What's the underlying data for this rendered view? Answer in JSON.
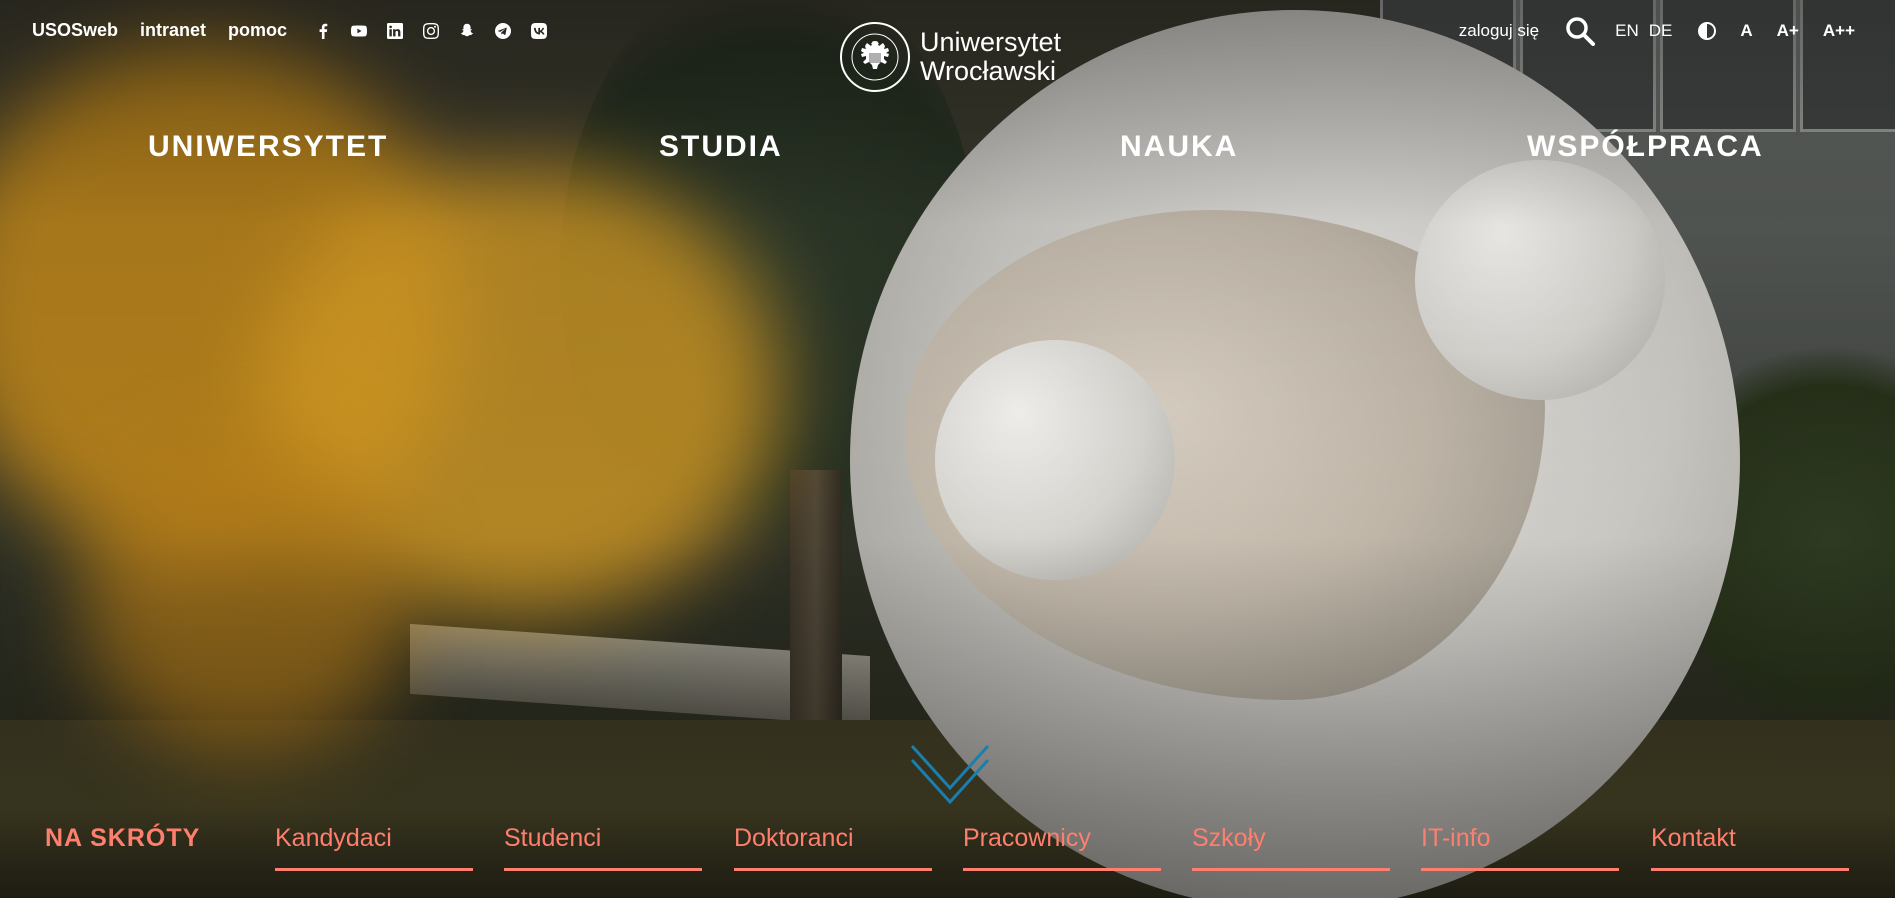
{
  "topbar": {
    "links": [
      "USOSweb",
      "intranet",
      "pomoc"
    ],
    "social_icons": [
      "facebook-icon",
      "youtube-icon",
      "linkedin-icon",
      "instagram-icon",
      "snapchat-icon",
      "telegram-icon",
      "vk-icon"
    ],
    "login_label": "zaloguj się",
    "languages": [
      "EN",
      "DE"
    ],
    "font_size_options": [
      "A",
      "A+",
      "A++"
    ]
  },
  "logo": {
    "line1": "Uniwersytet",
    "line2": "Wrocławski"
  },
  "main_nav": [
    "UNIWERSYTET",
    "STUDIA",
    "NAUKA",
    "WSPÓŁPRACA"
  ],
  "shortcuts": {
    "title": "NA SKRÓTY",
    "items": [
      "Kandydaci",
      "Studenci",
      "Doktoranci",
      "Pracownicy",
      "Szkoły",
      "IT-info",
      "Kontakt"
    ]
  },
  "colors": {
    "accent": "#ff7f6e",
    "chevron": "#1a7fb0",
    "text": "#ffffff"
  }
}
